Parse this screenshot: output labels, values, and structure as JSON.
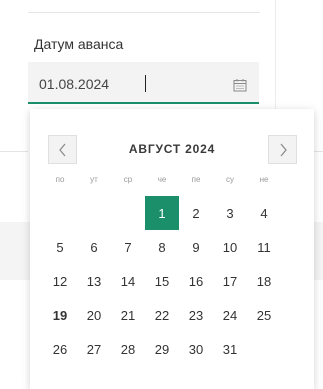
{
  "field": {
    "label": "Датум аванса",
    "value": "01.08.2024",
    "icon": "calendar-icon"
  },
  "calendar": {
    "month_title": "АВГУСТ 2024",
    "prev_icon": "chevron-left-icon",
    "next_icon": "chevron-right-icon",
    "weekdays": [
      "по",
      "ут",
      "ср",
      "че",
      "пе",
      "су",
      "не"
    ],
    "leading_blank_days": 3,
    "days": [
      "1",
      "2",
      "3",
      "4",
      "5",
      "6",
      "7",
      "8",
      "9",
      "10",
      "11",
      "12",
      "13",
      "14",
      "15",
      "16",
      "17",
      "18",
      "19",
      "20",
      "21",
      "22",
      "23",
      "24",
      "25",
      "26",
      "27",
      "28",
      "29",
      "30",
      "31"
    ],
    "selected_day": "1",
    "today_day": "19",
    "accent_color": "#1a8f6a"
  }
}
